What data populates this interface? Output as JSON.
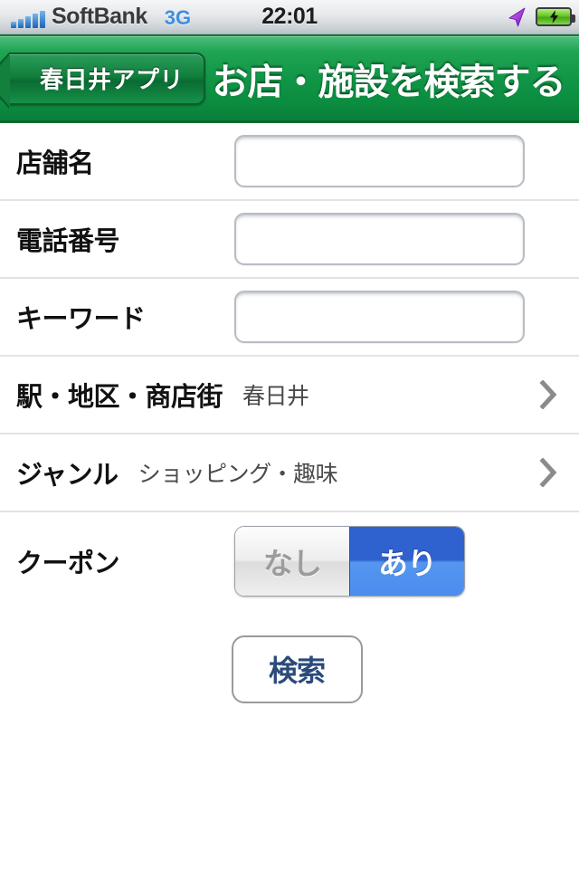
{
  "statusbar": {
    "carrier": "SoftBank",
    "network": "3G",
    "time": "22:01",
    "signal_bars": 5,
    "location_icon": "location-arrow-icon",
    "battery_icon": "battery-charging-icon"
  },
  "navbar": {
    "back_label": "春日井アプリ",
    "title": "お店・施設を検索する",
    "bar_color": "#0f9445"
  },
  "form": {
    "rows": [
      {
        "label": "店舗名",
        "type": "text",
        "value": "",
        "placeholder": ""
      },
      {
        "label": "電話番号",
        "type": "text",
        "value": "",
        "placeholder": ""
      },
      {
        "label": "キーワード",
        "type": "text",
        "value": "",
        "placeholder": ""
      },
      {
        "label": "駅・地区・商店街",
        "type": "select",
        "value": "春日井"
      },
      {
        "label": "ジャンル",
        "type": "select",
        "value": "ショッピング・趣味"
      },
      {
        "label": "クーポン",
        "type": "segment"
      }
    ],
    "segment": {
      "options": [
        "なし",
        "あり"
      ],
      "selected": "あり",
      "selected_color": "#3a72dd",
      "unselected_color": "#e3e3e3"
    },
    "submit_label": "検索"
  }
}
